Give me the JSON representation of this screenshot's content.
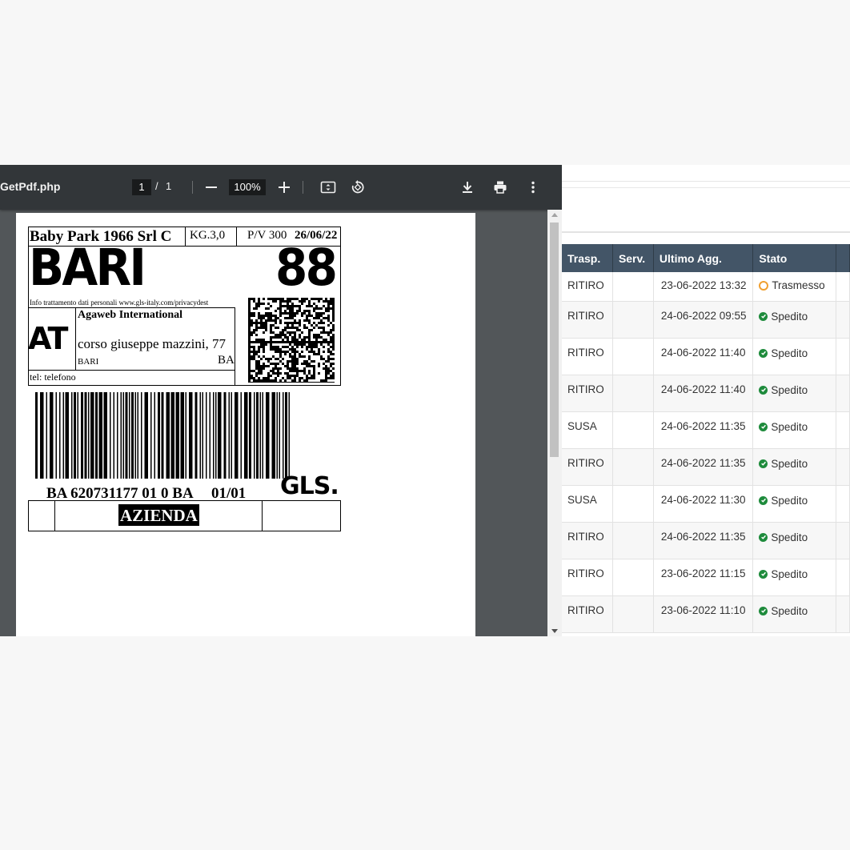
{
  "viewer": {
    "file_name": "GetPdf.php",
    "current_page": "1",
    "page_separator": "/",
    "total_pages": "1",
    "zoom": "100%"
  },
  "label": {
    "sender": "Baby Park 1966 Srl C",
    "weight": "KG.3,0",
    "pv": "P/V 300",
    "date": "26/06/22",
    "city": "BARI",
    "zone": "88",
    "privacy_note": "Info trattamento dati personali www.gls-italy.com/privacydest",
    "code_side": "AT",
    "recipient_name": "Agaweb International",
    "recipient_address": "corso giuseppe mazzini, 77",
    "recipient_city": "BARI",
    "recipient_province": "BA",
    "phone": "tel: telefono",
    "barcode_text": "BA 620731177 01 0 BA",
    "parcel_count": "01/01",
    "carrier": "GLS.",
    "type": "AZIENDA"
  },
  "table": {
    "headers": [
      "Trasp.",
      "Serv.",
      "Ultimo Agg.",
      "Stato"
    ],
    "rows": [
      {
        "trasp": "RITIRO",
        "serv": "",
        "date": "23-06-2022 13:32",
        "status": "Trasmesso",
        "kind": "pending"
      },
      {
        "trasp": "RITIRO",
        "serv": "",
        "date": "24-06-2022 09:55",
        "status": "Spedito",
        "kind": "ok"
      },
      {
        "trasp": "RITIRO",
        "serv": "",
        "date": "24-06-2022 11:40",
        "status": "Spedito",
        "kind": "ok"
      },
      {
        "trasp": "RITIRO",
        "serv": "",
        "date": "24-06-2022 11:40",
        "status": "Spedito",
        "kind": "ok"
      },
      {
        "trasp": "SUSA",
        "serv": "",
        "date": "24-06-2022 11:35",
        "status": "Spedito",
        "kind": "ok"
      },
      {
        "trasp": "RITIRO",
        "serv": "",
        "date": "24-06-2022 11:35",
        "status": "Spedito",
        "kind": "ok"
      },
      {
        "trasp": "SUSA",
        "serv": "",
        "date": "24-06-2022 11:30",
        "status": "Spedito",
        "kind": "ok"
      },
      {
        "trasp": "RITIRO",
        "serv": "",
        "date": "24-06-2022 11:35",
        "status": "Spedito",
        "kind": "ok"
      },
      {
        "trasp": "RITIRO",
        "serv": "",
        "date": "23-06-2022 11:15",
        "status": "Spedito",
        "kind": "ok"
      },
      {
        "trasp": "RITIRO",
        "serv": "",
        "date": "23-06-2022 11:10",
        "status": "Spedito",
        "kind": "ok"
      }
    ]
  },
  "colors": {
    "header_bg": "#435567",
    "ok": "#1e8b3c",
    "pending": "#f0a030",
    "toolbar": "#323639"
  }
}
